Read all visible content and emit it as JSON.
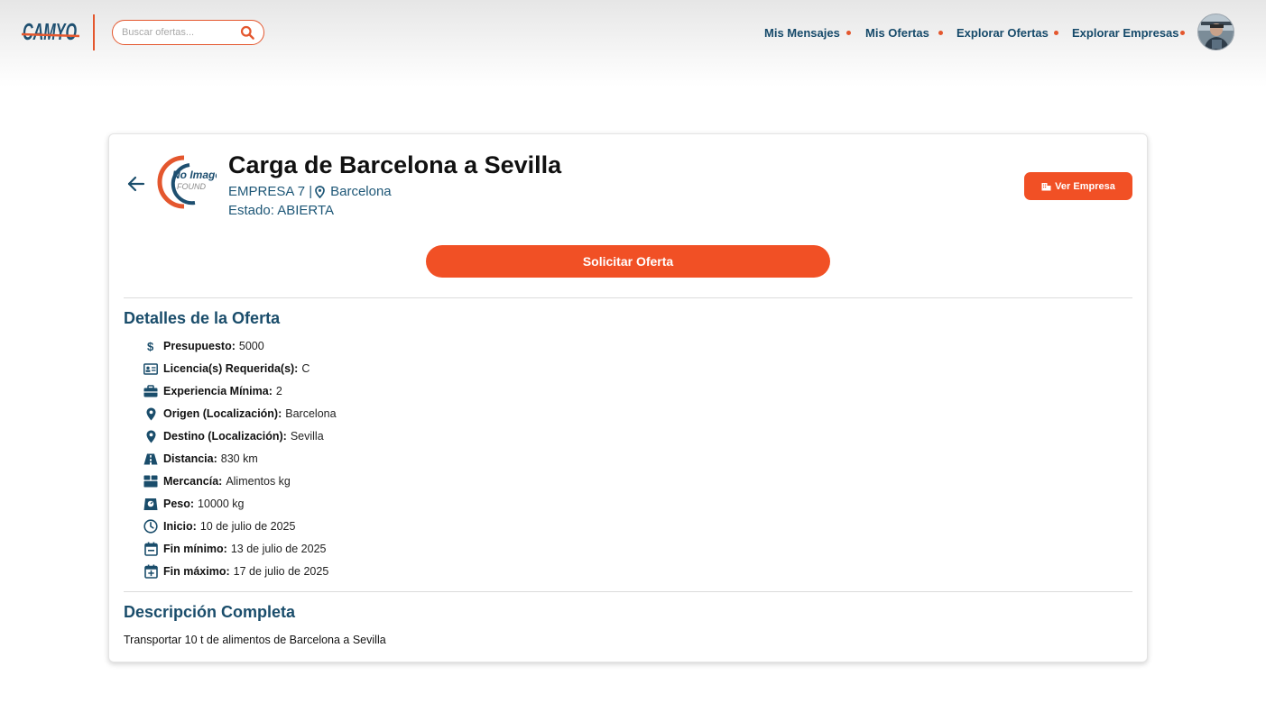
{
  "header": {
    "logo_text": "CAMYO",
    "search": {
      "placeholder": "Buscar ofertas..."
    },
    "nav": [
      "Mis Mensajes",
      "Mis Ofertas",
      "Explorar Ofertas",
      "Explorar Empresas"
    ]
  },
  "offer": {
    "company_logo_text": [
      "No Image",
      "FOUND"
    ],
    "title": "Carga de Barcelona a Sevilla",
    "company": "EMPRESA 7 |",
    "location": "Barcelona",
    "status": "Estado: ABIERTA",
    "ver_empresa_label": "Ver Empresa",
    "solicitar_label": "Solicitar Oferta"
  },
  "details": {
    "title": "Detalles de la Oferta",
    "items": [
      {
        "label": "Presupuesto:",
        "value": "5000",
        "icon": "dollar-icon"
      },
      {
        "label": "Licencia(s) Requerida(s):",
        "value": "C",
        "icon": "id-card-icon"
      },
      {
        "label": "Experiencia Mínima:",
        "value": "2",
        "icon": "briefcase-icon"
      },
      {
        "label": "Origen (Localización):",
        "value": "Barcelona",
        "icon": "location-pin-icon"
      },
      {
        "label": "Destino (Localización):",
        "value": "Sevilla",
        "icon": "location-pin-icon"
      },
      {
        "label": "Distancia:",
        "value": "830 km",
        "icon": "road-icon"
      },
      {
        "label": "Mercancía:",
        "value": "Alimentos kg",
        "icon": "box-icon"
      },
      {
        "label": "Peso:",
        "value": "10000 kg",
        "icon": "weight-icon"
      },
      {
        "label": "Inicio:",
        "value": "10 de julio de 2025",
        "icon": "clock-icon"
      },
      {
        "label": "Fin mínimo:",
        "value": "13 de julio de 2025",
        "icon": "calendar-icon"
      },
      {
        "label": "Fin máximo:",
        "value": "17 de julio de 2025",
        "icon": "calendar-plus-icon"
      }
    ]
  },
  "description": {
    "title": "Descripción Completa",
    "text": "Transportar 10 t de alimentos de Barcelona a Sevilla"
  },
  "colors": {
    "accent": "#f15025",
    "primary": "#1a4d6b",
    "nav_text": "#164a6a"
  }
}
